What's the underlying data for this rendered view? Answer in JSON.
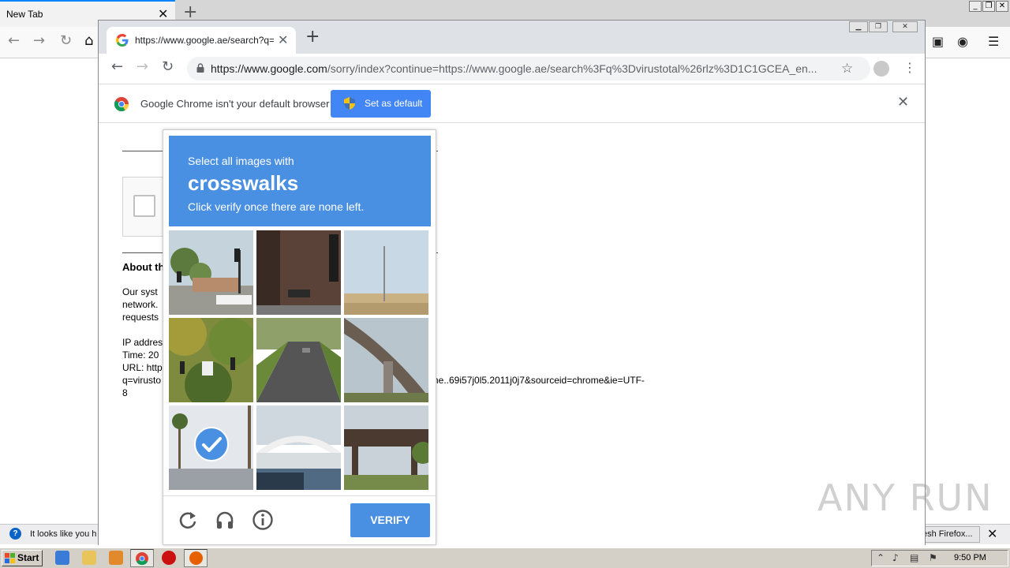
{
  "firefox": {
    "tab_title": "New Tab",
    "notification": "It looks like you h",
    "refresh_button": "esh Firefox..."
  },
  "chrome": {
    "tab_title": "https://www.google.ae/search?q=v",
    "url_host": "https://www.google.com",
    "url_rest": "/sorry/index?continue=https://www.google.ae/search%3Fq%3Dvirustotal%26rlz%3D1C1GCEA_en...",
    "infobar_text": "Google Chrome isn't your default browser",
    "set_default_label": "Set as default"
  },
  "page": {
    "about_heading": "About th",
    "para_lines": [
      "Our syst",
      "network.",
      "requests"
    ],
    "ip_lines": [
      "IP addres",
      "Time: 20",
      "URL: http",
      "q=virusto",
      "8"
    ],
    "url_tail": "ome..69i57j0l5.2011j0j7&sourceid=chrome&ie=UTF-"
  },
  "captcha": {
    "prompt_small": "Select all images with",
    "target": "crosswalks",
    "prompt_sub": "Click verify once there are none left.",
    "verify_label": "VERIFY",
    "tiles": [
      {
        "name": "tile-traffic-light-street",
        "selected": false
      },
      {
        "name": "tile-building-traffic-light",
        "selected": false
      },
      {
        "name": "tile-open-field",
        "selected": false
      },
      {
        "name": "tile-traffic-light-trees",
        "selected": false
      },
      {
        "name": "tile-residential-street",
        "selected": false
      },
      {
        "name": "tile-overpass",
        "selected": false
      },
      {
        "name": "tile-palm-tree-road",
        "selected": true
      },
      {
        "name": "tile-bridge-arch",
        "selected": false
      },
      {
        "name": "tile-underpass",
        "selected": false
      }
    ]
  },
  "watermark": "ANY RUN",
  "taskbar": {
    "start_label": "Start",
    "clock": "9:50 PM"
  },
  "colors": {
    "captcha_blue": "#4a90e2",
    "chrome_button_blue": "#4285f4",
    "taskbar_gray": "#d4d0c8"
  }
}
